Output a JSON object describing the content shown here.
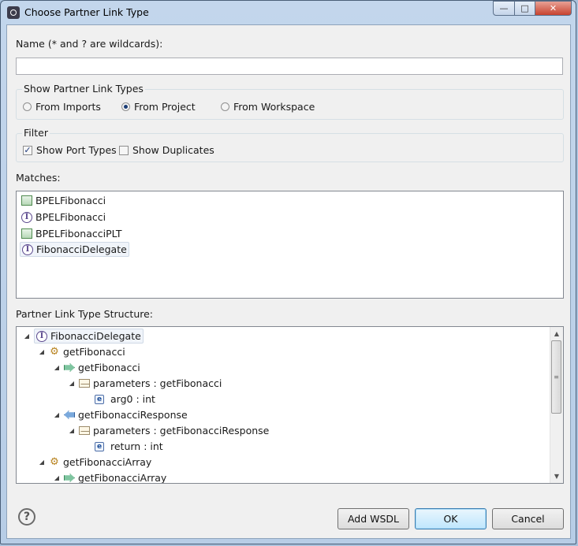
{
  "window": {
    "title": "Choose Partner Link Type",
    "app_icon": "eclipse-icon",
    "controls": {
      "minimize": "—",
      "maximize": "□",
      "close": "✕"
    }
  },
  "name_field": {
    "label": "Name (* and ? are wildcards):",
    "value": "",
    "placeholder": ""
  },
  "show_group": {
    "title": "Show Partner Link Types",
    "options": [
      {
        "label": "From Imports",
        "selected": false
      },
      {
        "label": "From Project",
        "selected": true
      },
      {
        "label": "From Workspace",
        "selected": false
      }
    ]
  },
  "filter_group": {
    "title": "Filter",
    "options": [
      {
        "label": "Show Port Types",
        "checked": true
      },
      {
        "label": "Show Duplicates",
        "checked": false
      }
    ]
  },
  "matches": {
    "label": "Matches:",
    "items": [
      {
        "label": "BPELFibonacci",
        "icon": "partner-link-type-icon"
      },
      {
        "label": "BPELFibonacci",
        "icon": "port-type-icon"
      },
      {
        "label": "BPELFibonacciPLT",
        "icon": "partner-link-type-icon"
      },
      {
        "label": "FibonacciDelegate",
        "icon": "port-type-icon",
        "selected": true
      }
    ]
  },
  "structure": {
    "label": "Partner Link Type Structure:",
    "nodes": [
      {
        "label": "FibonacciDelegate",
        "icon": "port-type-icon",
        "depth": 0
      },
      {
        "label": "getFibonacci",
        "icon": "operation-icon",
        "depth": 1
      },
      {
        "label": "getFibonacci",
        "icon": "input-icon",
        "depth": 2
      },
      {
        "label": "parameters : getFibonacci",
        "icon": "message-icon",
        "depth": 3
      },
      {
        "label": "arg0 : int",
        "icon": "element-icon",
        "depth": 4
      },
      {
        "label": "getFibonacciResponse",
        "icon": "output-icon",
        "depth": 2
      },
      {
        "label": "parameters : getFibonacciResponse",
        "icon": "message-icon",
        "depth": 3
      },
      {
        "label": "return : int",
        "icon": "element-icon",
        "depth": 4
      },
      {
        "label": "getFibonacciArray",
        "icon": "operation-icon",
        "depth": 1
      },
      {
        "label": "getFibonacciArray",
        "icon": "input-icon",
        "depth": 2
      }
    ]
  },
  "buttons": {
    "help": "?",
    "add_wsdl": "Add WSDL",
    "ok": "OK",
    "cancel": "Cancel"
  }
}
